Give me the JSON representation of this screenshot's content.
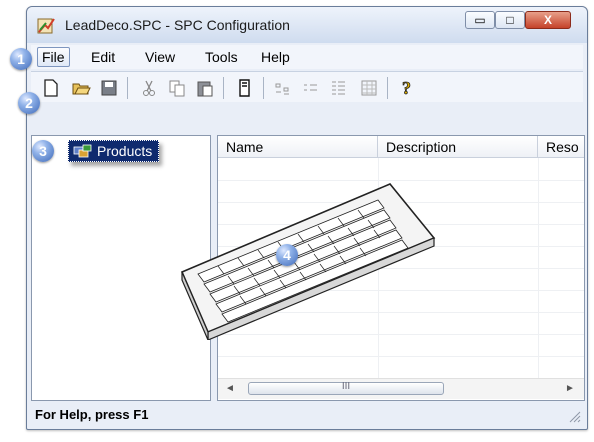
{
  "window": {
    "title": "LeadDeco.SPC - SPC Configuration",
    "minimize_glyph": "▭",
    "maximize_glyph": "□",
    "close_glyph": "X"
  },
  "menubar": {
    "items": [
      "File",
      "Edit",
      "View",
      "Tools",
      "Help"
    ]
  },
  "toolbar": {
    "icons": [
      "new-document-icon",
      "open-folder-icon",
      "save-icon",
      "cut-icon",
      "copy-icon",
      "paste-icon",
      "properties-icon",
      "small-icons-icon",
      "list-icon",
      "details-icon",
      "grid-icon",
      "help-icon"
    ]
  },
  "tree": {
    "root_label": "Products"
  },
  "list": {
    "columns": [
      "Name",
      "Description",
      "Reso"
    ]
  },
  "scrollbar": {
    "left_arrow": "◄",
    "right_arrow": "►",
    "grip": "III"
  },
  "status": {
    "text": "For Help, press F1"
  },
  "callouts": [
    "1",
    "2",
    "3",
    "4"
  ],
  "colors": {
    "selection": "#0f2a6e",
    "callout": "#3d68b8",
    "close_button": "#c5422a"
  }
}
